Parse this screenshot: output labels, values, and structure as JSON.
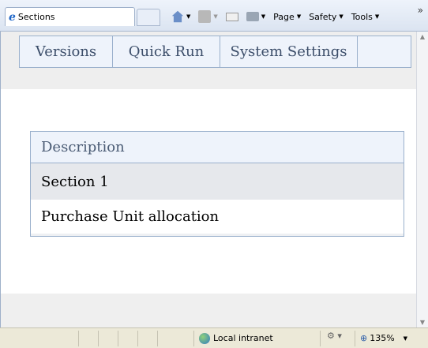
{
  "browser": {
    "tab_title": "Sections",
    "toolbar": {
      "page_label": "Page",
      "safety_label": "Safety",
      "tools_label": "Tools"
    },
    "status": {
      "zone_label": "Local intranet",
      "zoom_label": "135%"
    }
  },
  "nav": {
    "items": [
      {
        "label": "Versions"
      },
      {
        "label": "Quick Run"
      },
      {
        "label": "System Settings"
      }
    ]
  },
  "table": {
    "header": "Description",
    "section_label": "Section 1",
    "rows": [
      {
        "label": "Purchase Unit allocation"
      }
    ]
  },
  "icons": {
    "tab": "ie-logo-icon",
    "home": "home-icon",
    "feeds": "rss-icon",
    "mail": "mail-icon",
    "print": "print-icon",
    "zone": "globe-icon",
    "zoom": "zoom-icon"
  },
  "colors": {
    "nav_bg": "#eef3fb",
    "border": "#9ab0cc",
    "nav_text": "#3c4e6a",
    "section_bg": "#e6e8ec"
  }
}
